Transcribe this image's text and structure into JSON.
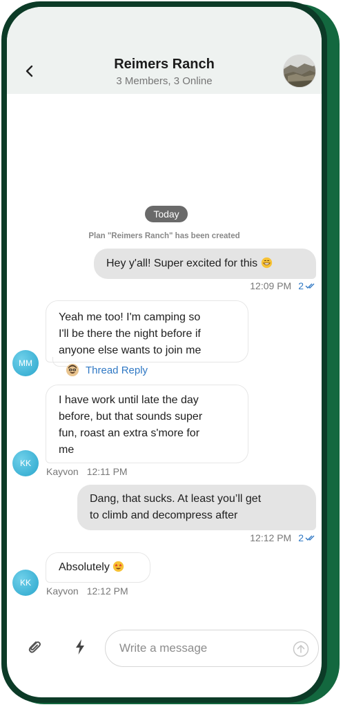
{
  "header": {
    "title": "Reimers Ranch",
    "subtitle": "3 Members, 3 Online",
    "back_icon": "chevron-left-icon",
    "avatar_icon": "landscape-photo"
  },
  "date_divider": "Today",
  "system_message": "Plan \"Reimers Ranch\" has been created",
  "messages": [
    {
      "direction": "out",
      "text": "Hey y'all! Super excited for this",
      "emoji": "grinning-face",
      "time": "12:09 PM",
      "read_count": "2"
    },
    {
      "direction": "in",
      "line1": "Yeah me too! I'm camping so",
      "line2": "I'll be there the night before if",
      "line3": "anyone else wants to join me",
      "avatar_initials": "MM",
      "thread_reply_label": "Thread Reply"
    },
    {
      "direction": "in",
      "line1": "I have work until late the day",
      "line2": "before, but that sounds super",
      "line3": "fun, roast an extra s'more for",
      "line4": "me",
      "avatar_initials": "KK",
      "sender": "Kayvon",
      "time": "12:11 PM"
    },
    {
      "direction": "out",
      "line1": "Dang, that sucks. At least you’ll get",
      "line2": "to climb and decompress after",
      "time": "12:12 PM",
      "read_count": "2"
    },
    {
      "direction": "in",
      "text": "Absolutely",
      "emoji": "star-struck-face",
      "avatar_initials": "KK",
      "sender": "Kayvon",
      "time": "12:12 PM"
    }
  ],
  "composer": {
    "placeholder": "Write a message",
    "attach_icon": "paperclip-icon",
    "quick_icon": "lightning-bolt-icon",
    "send_icon": "arrow-up-circle-icon"
  },
  "colors": {
    "phone_frame": "#0c3b27",
    "phone_edge": "#13683f",
    "header_bg": "#eef2f0",
    "outgoing_bubble": "#e4e4e4",
    "accent_blue": "#2f78c4",
    "avatar_blue": "#2aa6cc",
    "date_pill": "#6a6a6a"
  }
}
